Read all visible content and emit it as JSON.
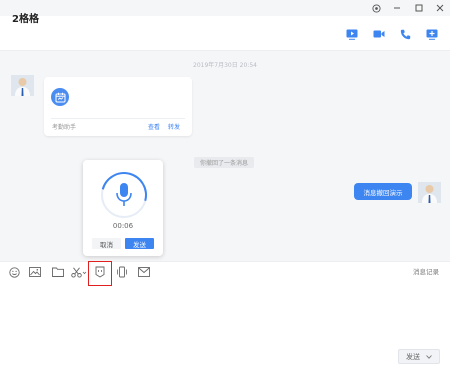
{
  "window": {
    "controls": [
      "target-icon",
      "minimize-icon",
      "maximize-icon",
      "close-icon"
    ]
  },
  "header": {
    "title": "2格格",
    "icons": [
      "video-play-icon",
      "video-call-icon",
      "phone-icon",
      "screen-share-icon"
    ]
  },
  "chat": {
    "timestamp": "2019年7月30日 20:54",
    "card": {
      "icon": "calendar-icon",
      "label": "考勤助手",
      "view": "查看",
      "forward": "转发"
    },
    "recall_notice": "你撤回了一条消息",
    "outgoing_message": "消息撤回演示"
  },
  "voice_recorder": {
    "duration": "00:06",
    "cancel": "取消",
    "send": "发送"
  },
  "toolbar": {
    "icons": [
      "emoji-icon",
      "image-icon",
      "folder-icon",
      "scissors-icon",
      "voice-message-icon",
      "vibrate-icon",
      "mail-icon"
    ],
    "history": "消息记录"
  },
  "composer": {
    "send_label": "发送"
  },
  "colors": {
    "accent": "#3d85f0",
    "highlight": "#e02020",
    "chat_bg": "#f5f6f8"
  }
}
